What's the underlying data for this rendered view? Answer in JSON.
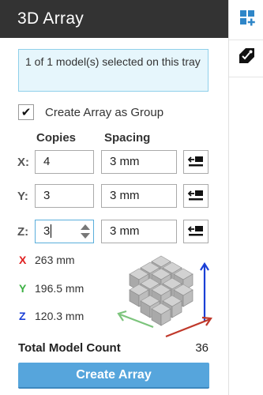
{
  "panel": {
    "title": "3D Array",
    "info_message": "1 of 1 model(s) selected on this tray",
    "create_as_group": {
      "label": "Create Array as Group",
      "checked": true
    },
    "columns": {
      "copies": "Copies",
      "spacing": "Spacing"
    },
    "rows": [
      {
        "axis": "X:",
        "copies": "4",
        "spacing": "3 mm"
      },
      {
        "axis": "Y:",
        "copies": "3",
        "spacing": "3 mm"
      },
      {
        "axis": "Z:",
        "copies": "3",
        "spacing": "3 mm"
      }
    ],
    "dimensions": [
      {
        "axis": "X",
        "value": "263 mm",
        "color": "#e02020"
      },
      {
        "axis": "Y",
        "value": "196.5 mm",
        "color": "#3cb043"
      },
      {
        "axis": "Z",
        "value": "120.3 mm",
        "color": "#1a3fd6"
      }
    ],
    "total_label": "Total Model Count",
    "total_value": "36",
    "create_button": "Create Array"
  },
  "toolbar": {
    "tools": [
      {
        "icon": "add-grid-icon",
        "color": "#2f86c8"
      },
      {
        "icon": "tag-edit-icon",
        "color": "#111111"
      }
    ]
  },
  "colors": {
    "header_bg": "#333333",
    "accent": "#56a5dc",
    "info_bg": "#e6f6fc"
  }
}
